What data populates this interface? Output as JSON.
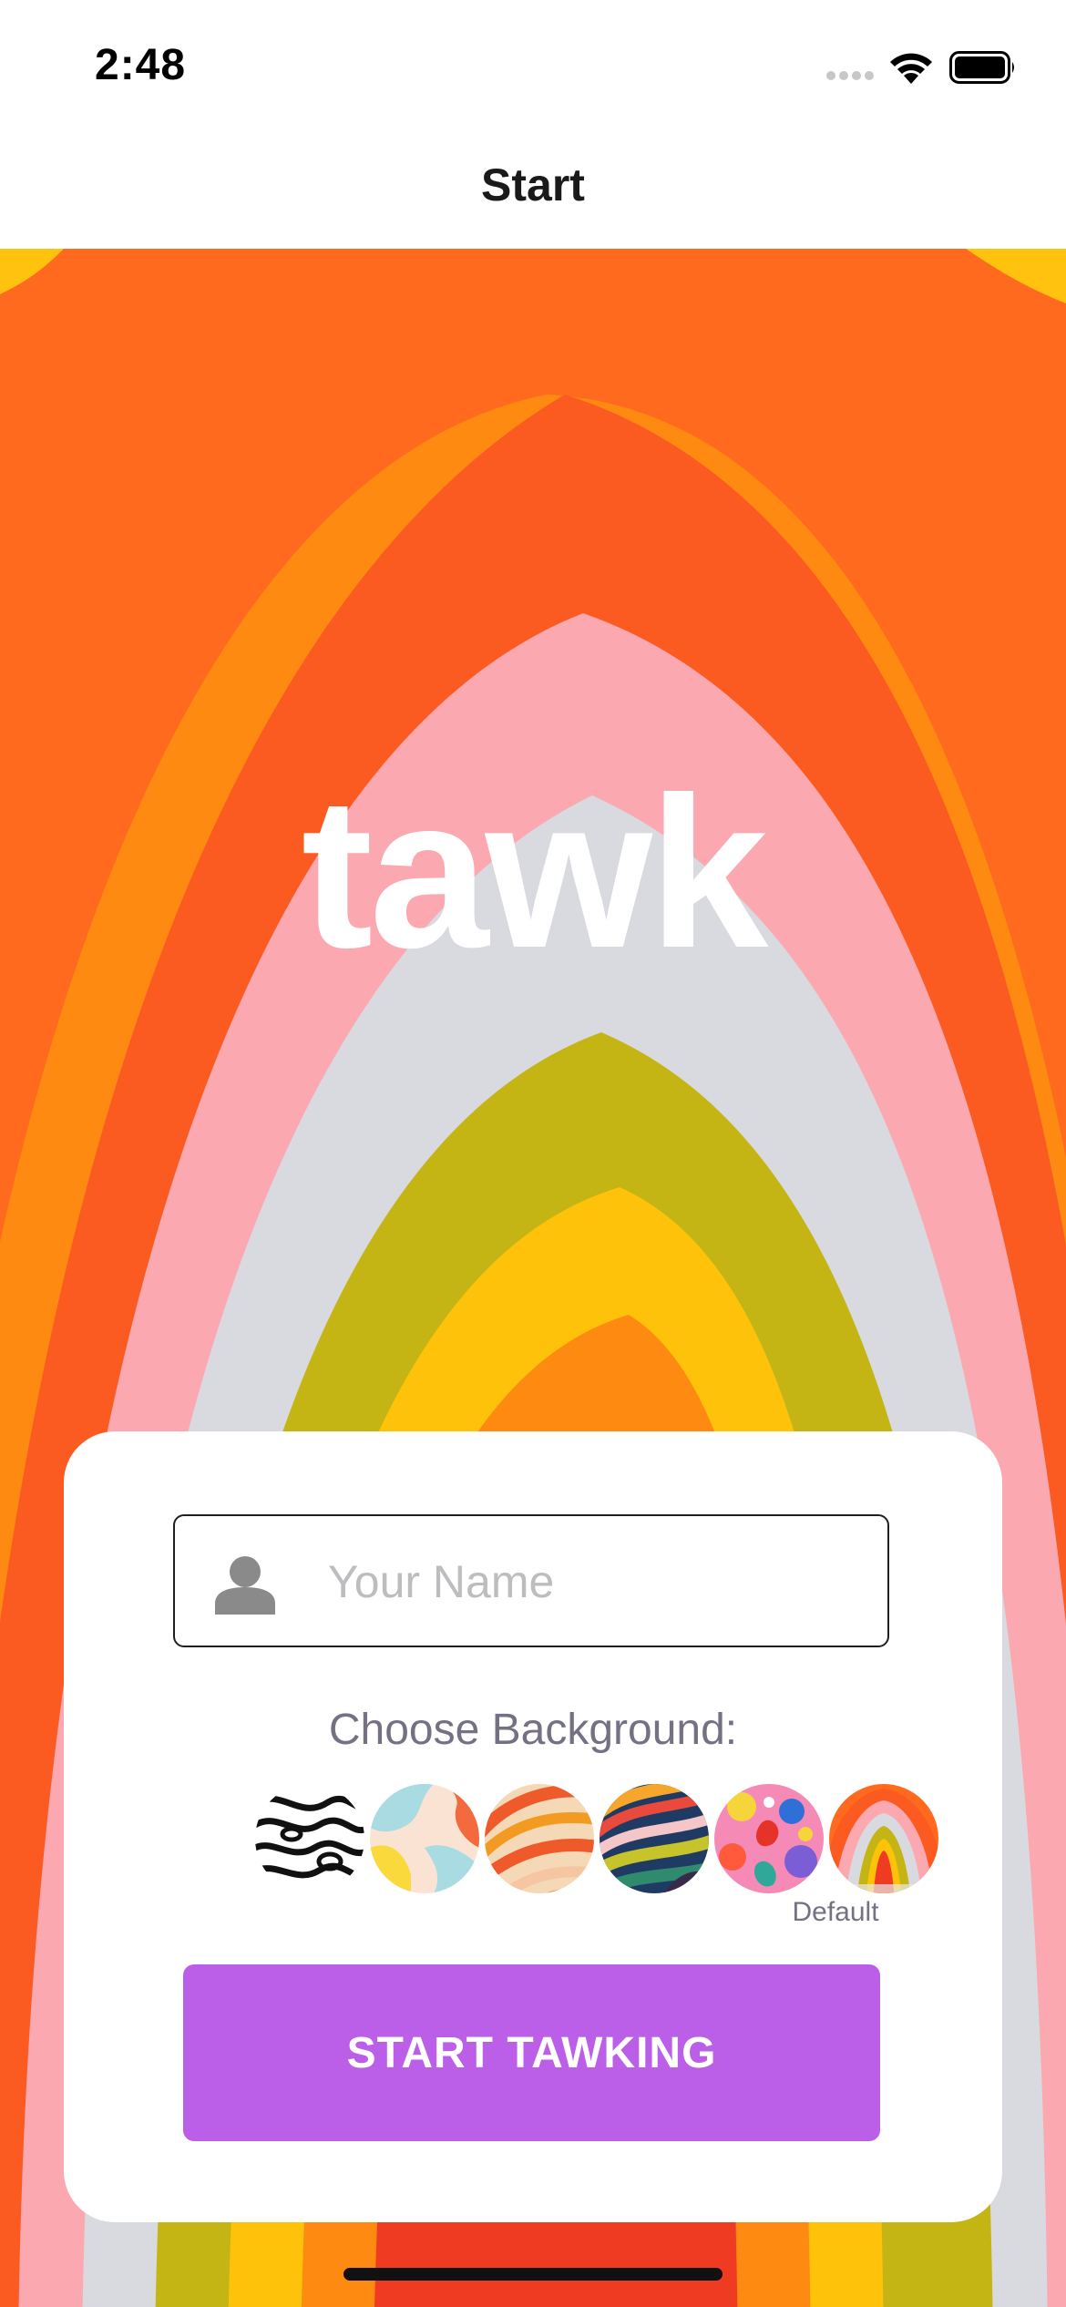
{
  "status_bar": {
    "time": "2:48",
    "icons": [
      "cellular-signal-icon",
      "wifi-icon",
      "battery-icon"
    ]
  },
  "nav": {
    "title": "Start"
  },
  "hero": {
    "logo_text": "tawk"
  },
  "form": {
    "name_placeholder": "Your Name",
    "name_value": "",
    "choose_background_label": "Choose Background:",
    "backgrounds": [
      {
        "name": "black-white-marble-pattern"
      },
      {
        "name": "pastel-wave-pattern"
      },
      {
        "name": "orange-stripes-pattern"
      },
      {
        "name": "rainbow-curves-pattern"
      },
      {
        "name": "floral-pattern"
      },
      {
        "name": "default-rainbow-arch",
        "caption": "Default"
      }
    ],
    "start_button_label": "START TAWKING"
  },
  "colors": {
    "accent": "#bb5fe8",
    "label_text": "#757083",
    "placeholder_text": "#bdbdbf"
  }
}
